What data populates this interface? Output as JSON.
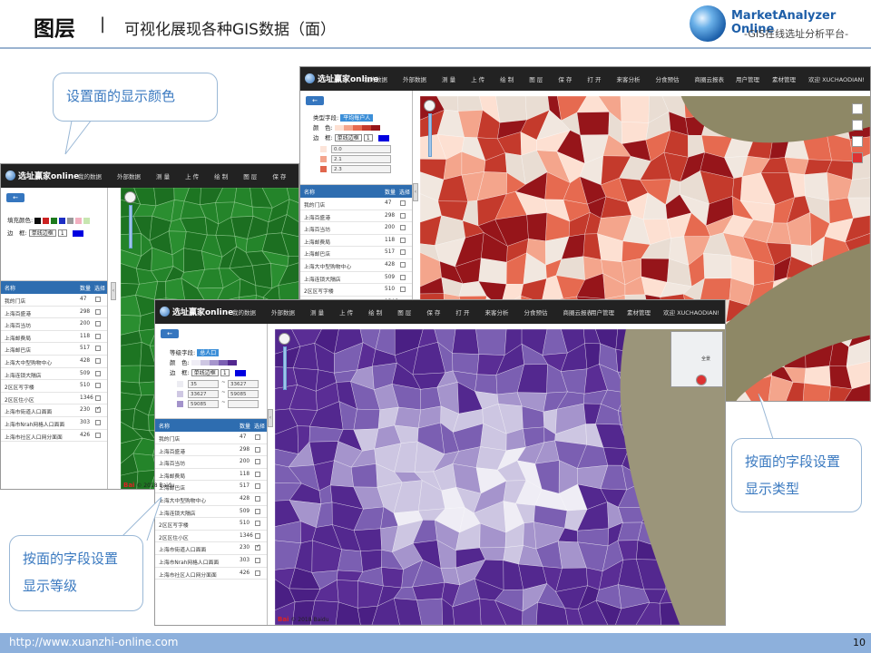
{
  "slide": {
    "title": "图层",
    "separator": "|",
    "subtitle": "可视化展现各种GIS数据（面）",
    "logo_name": "MarketAnalyzer Online",
    "logo_tagline": "-GIS在线选址分析平台-",
    "footer_url": "http://www.xuanzhi-online.com",
    "page_number": "10"
  },
  "callouts": {
    "color": "设置面的显示颜色",
    "type": "按面的字段设置显示类型",
    "level": "按面的字段设置显示等级"
  },
  "app": {
    "brand": "选址赢家online",
    "menu": [
      "我的数据",
      "外部数据",
      "测 量",
      "上 传",
      "绘 制",
      "图 层",
      "保 存",
      "打 开",
      "来客分析",
      "分食预估",
      "商圈云报表"
    ],
    "right_menu": [
      "用户管理",
      "素材管理",
      "欢迎 XUCHAODIAN!"
    ],
    "table_header": {
      "name": "名称",
      "count": "数量",
      "select": "选择"
    },
    "layers": [
      {
        "name": "我的门店",
        "count": "47",
        "checked": false
      },
      {
        "name": "上海百盛港",
        "count": "298",
        "checked": false
      },
      {
        "name": "上海百当坊",
        "count": "200",
        "checked": false
      },
      {
        "name": "上海邮费局",
        "count": "118",
        "checked": false
      },
      {
        "name": "上海邮巴店",
        "count": "517",
        "checked": false
      },
      {
        "name": "上海大中型购物中心",
        "count": "428",
        "checked": false
      },
      {
        "name": "上海连锁大隔店",
        "count": "509",
        "checked": false
      },
      {
        "name": "2区区写字楼",
        "count": "510",
        "checked": false
      },
      {
        "name": "2区区住小区",
        "count": "1346",
        "checked": false
      },
      {
        "name": "上海市街道人口面面",
        "count": "230",
        "checked": true
      },
      {
        "name": "上海市Nrah网格人口面面",
        "count": "303",
        "checked": false
      },
      {
        "name": "上海市社区人口网分面面",
        "count": "426",
        "checked": false
      }
    ]
  },
  "panel_green": {
    "fill_label": "填充颜色:",
    "fill_colors": [
      "#0b0b0b",
      "#cc2222",
      "#1d7a1d",
      "#1c2ec4",
      "#9a9a9a",
      "#f2b0c0",
      "#c7e6b0"
    ],
    "border_label": "边　框:",
    "border_style": "单线边框",
    "border_width": "1",
    "border_color": "#0000e0"
  },
  "panel_red": {
    "type_label": "类型字段:",
    "type_value": "平均每户人",
    "color_label": "颜　色:",
    "border_label": "边　框:",
    "border_style": "单线边框",
    "border_width": "1",
    "legend": [
      {
        "color": "#fce4d9",
        "value": "0.0"
      },
      {
        "color": "#f3a58d",
        "value": "2.1"
      },
      {
        "color": "#e0664d",
        "value": "2.3"
      }
    ],
    "ramp": [
      "#fde0d2",
      "#f4a58c",
      "#e66a50",
      "#c43a2c",
      "#96151a"
    ]
  },
  "panel_purple": {
    "level_label": "等级字段:",
    "level_value": "总人口",
    "color_label": "颜　色:",
    "border_label": "边　框:",
    "border_style": "单线边框",
    "border_width": "1",
    "legend": [
      {
        "color": "#ececf2",
        "from": "35",
        "to": "33627"
      },
      {
        "color": "#cfc8e3",
        "from": "33627",
        "to": "59085"
      },
      {
        "color": "#a393cb",
        "from": "59085",
        "to": ""
      }
    ],
    "ramp": [
      "#efedf5",
      "#cdc6e2",
      "#a594cc",
      "#7b5fb2",
      "#53288f"
    ]
  },
  "map": {
    "attribution": "© 2018 Baidu",
    "baidu": "Bai",
    "minimap_label": "全景"
  },
  "icons": {
    "back": "back-arrow-icon",
    "globe": "globe-icon",
    "pan": "pan-control-icon"
  }
}
